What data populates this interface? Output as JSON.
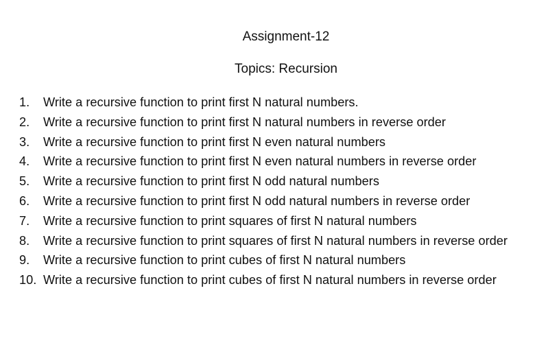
{
  "document": {
    "title": "Assignment-12",
    "subtitle": "Topics: Recursion",
    "items": [
      {
        "number": "1.",
        "text": "Write a recursive function to print first N natural numbers."
      },
      {
        "number": "2.",
        "text": "Write a recursive function to print first N natural numbers in reverse order"
      },
      {
        "number": "3.",
        "text": "Write a recursive function to print first N even natural numbers"
      },
      {
        "number": "4.",
        "text": "Write a recursive function to print first N even natural numbers in reverse order"
      },
      {
        "number": "5.",
        "text": "Write a recursive function to print first N odd natural numbers"
      },
      {
        "number": "6.",
        "text": "Write a recursive function to print first N odd natural numbers in reverse order"
      },
      {
        "number": "7.",
        "text": "Write a recursive function to print squares of first N natural numbers"
      },
      {
        "number": "8.",
        "text": "Write a recursive function to print squares of first N natural numbers in reverse order"
      },
      {
        "number": "9.",
        "text": "Write a recursive function to print cubes of first N natural numbers"
      },
      {
        "number": "10.",
        "text": "Write a recursive function to print cubes of first N natural numbers in reverse order"
      }
    ]
  }
}
